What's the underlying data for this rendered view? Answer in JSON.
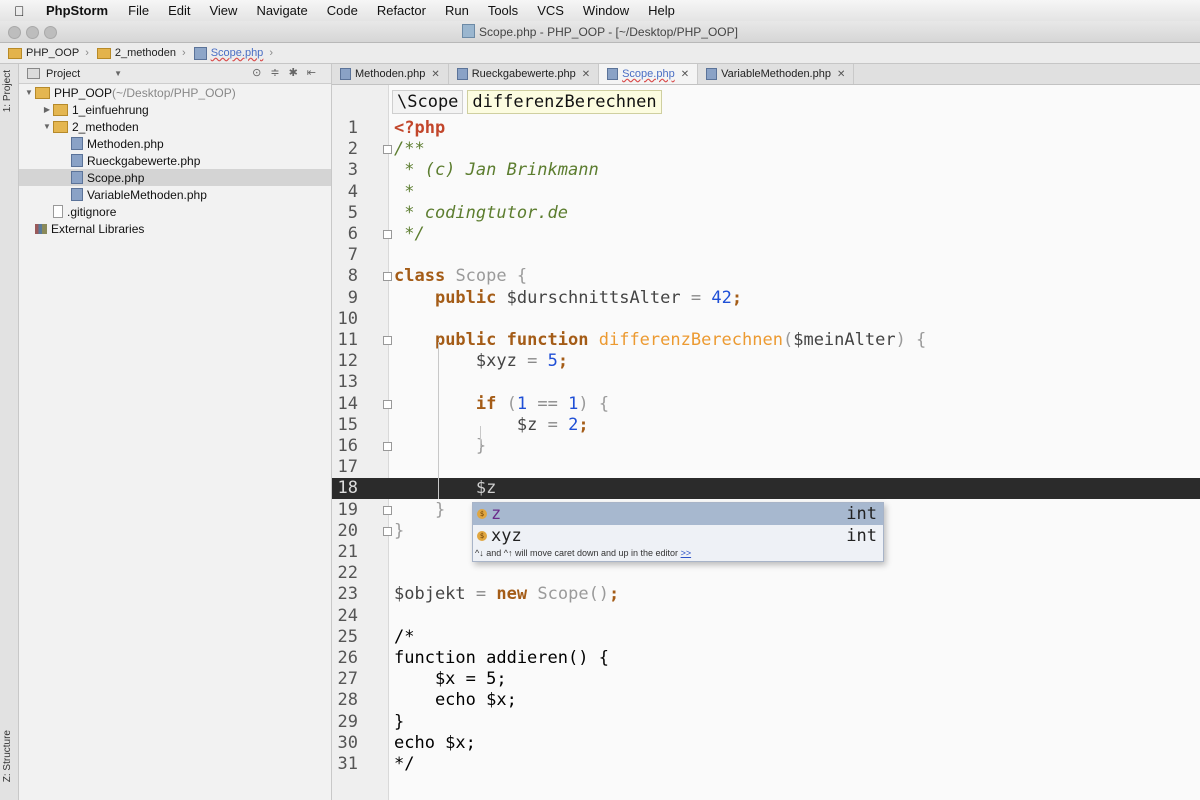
{
  "menubar": {
    "app_name": "PhpStorm",
    "items": [
      "File",
      "Edit",
      "View",
      "Navigate",
      "Code",
      "Refactor",
      "Run",
      "Tools",
      "VCS",
      "Window",
      "Help"
    ]
  },
  "window": {
    "title": "Scope.php - PHP_OOP - [~/Desktop/PHP_OOP]"
  },
  "breadcrumbs": [
    "PHP_OOP",
    "2_methoden",
    "Scope.php"
  ],
  "left_strip": {
    "project_label": "1: Project",
    "structure_label": "Z: Structure"
  },
  "project_panel": {
    "view_mode": "Project",
    "tree": [
      {
        "label": "PHP_OOP",
        "suffix": "(~/Desktop/PHP_OOP)",
        "type": "folder",
        "depth": 0,
        "expanded": true
      },
      {
        "label": "1_einfuehrung",
        "type": "folder",
        "depth": 1,
        "expanded": false
      },
      {
        "label": "2_methoden",
        "type": "folder",
        "depth": 1,
        "expanded": true
      },
      {
        "label": "Methoden.php",
        "type": "php",
        "depth": 2
      },
      {
        "label": "Rueckgabewerte.php",
        "type": "php",
        "depth": 2
      },
      {
        "label": "Scope.php",
        "type": "php",
        "depth": 2,
        "selected": true
      },
      {
        "label": "VariableMethoden.php",
        "type": "php",
        "depth": 2
      },
      {
        "label": ".gitignore",
        "type": "text",
        "depth": 1
      },
      {
        "label": "External Libraries",
        "type": "lib",
        "depth": 0
      }
    ]
  },
  "tabs": [
    {
      "label": "Methoden.php",
      "active": false
    },
    {
      "label": "Rueckgabewerte.php",
      "active": false
    },
    {
      "label": "Scope.php",
      "active": true
    },
    {
      "label": "VariableMethoden.php",
      "active": false
    }
  ],
  "editor_breadcrumb": [
    "\\Scope",
    "differenzBerechnen"
  ],
  "code": [
    {
      "n": "1",
      "html": "<span class='tag'>&lt;?php</span>"
    },
    {
      "n": "2",
      "html": "<span class='c'>/**</span>",
      "fold": true
    },
    {
      "n": "3",
      "html": "<span class='c'> * (c) Jan Brinkmann</span>"
    },
    {
      "n": "4",
      "html": "<span class='c'> *</span>"
    },
    {
      "n": "5",
      "html": "<span class='c'> * codingtutor.de</span>"
    },
    {
      "n": "6",
      "html": "<span class='c'> */</span>",
      "fold": true
    },
    {
      "n": "7",
      "html": ""
    },
    {
      "n": "8",
      "html": "<span class='k'>class</span> <span class='cls'>Scope</span> <span class='dim'>{</span>",
      "fold": true
    },
    {
      "n": "9",
      "html": "    <span class='k'>public</span> <span class='var'>$durschnittsAlter</span> <span class='op'>=</span> <span class='num'>42</span><span class='k'>;</span>"
    },
    {
      "n": "10",
      "html": ""
    },
    {
      "n": "11",
      "html": "    <span class='k'>public function</span> <span class='fn'>differenzBerechnen</span><span class='dim'>(</span><span class='var'>$meinAlter</span><span class='dim'>) {</span>",
      "fold": true
    },
    {
      "n": "12",
      "html": "        <span class='var'>$xyz</span> <span class='op'>=</span> <span class='num'>5</span><span class='k'>;</span>"
    },
    {
      "n": "13",
      "html": ""
    },
    {
      "n": "14",
      "html": "        <span class='k'>if</span> <span class='dim'>(</span><span class='num'>1</span> <span class='op'>==</span> <span class='num'>1</span><span class='dim'>) {</span>",
      "fold": true
    },
    {
      "n": "15",
      "html": "            <span class='var'>$z</span> <span class='op'>=</span> <span class='num'>2</span><span class='k'>;</span>"
    },
    {
      "n": "16",
      "html": "        <span class='dim'>}</span>",
      "fold": true
    },
    {
      "n": "17",
      "html": ""
    },
    {
      "n": "18",
      "html": "        <span class='var'>$z</span>",
      "current": true
    },
    {
      "n": "19",
      "html": "    <span class='dim'>}</span>",
      "fold": true
    },
    {
      "n": "20",
      "html": "<span class='dim'>}</span>",
      "fold": true
    },
    {
      "n": "21",
      "html": ""
    },
    {
      "n": "22",
      "html": ""
    },
    {
      "n": "23",
      "html": "<span class='var'>$objekt</span> <span class='op'>=</span> <span class='k'>new</span> <span class='cls'>Scope</span><span class='dim'>()</span><span class='k'>;</span>"
    },
    {
      "n": "24",
      "html": ""
    },
    {
      "n": "25",
      "html": "/*"
    },
    {
      "n": "26",
      "html": "function addieren() {"
    },
    {
      "n": "27",
      "html": "    $x = 5;"
    },
    {
      "n": "28",
      "html": "    echo $x;"
    },
    {
      "n": "29",
      "html": "}"
    },
    {
      "n": "30",
      "html": "echo $x;"
    },
    {
      "n": "31",
      "html": "*/"
    }
  ],
  "completion": {
    "items": [
      {
        "name": "z",
        "type": "int",
        "selected": true
      },
      {
        "name": "xyz",
        "type": "int",
        "selected": false
      }
    ],
    "hint": "^↓ and ^↑ will move caret down and up in the editor",
    "hint_link": ">>"
  }
}
